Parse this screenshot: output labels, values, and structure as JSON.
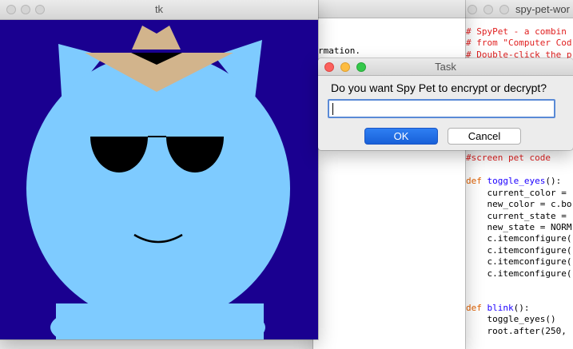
{
  "tk_window": {
    "title": "tk"
  },
  "shell_window": {
    "text": "rmation."
  },
  "code_window": {
    "title": "spy-pet-wor",
    "lines": [
      {
        "t": "# SpyPet - a combin",
        "c": "c-red"
      },
      {
        "t": "# from \"Computer Cod",
        "c": "c-red"
      },
      {
        "t": "# Double-click the p",
        "c": "c-red"
      },
      {
        "t": "",
        "c": ""
      },
      {
        "t": "",
        "c": ""
      },
      {
        "t": "",
        "c": ""
      },
      {
        "t": "",
        "c": ""
      },
      {
        "t": "",
        "c": ""
      },
      {
        "t": "",
        "c": ""
      },
      {
        "t": "",
        "c": ""
      },
      {
        "t": "",
        "c": ""
      },
      {
        "t": "#screen pet code",
        "c": "c-red"
      },
      {
        "t": "",
        "c": ""
      },
      {
        "t": "def toggle_eyes():",
        "c": "def"
      },
      {
        "t": "    current_color =",
        "c": ""
      },
      {
        "t": "    new_color = c.bo",
        "c": ""
      },
      {
        "t": "    current_state =",
        "c": ""
      },
      {
        "t": "    new_state = NORM",
        "c": ""
      },
      {
        "t": "    c.itemconfigure(",
        "c": ""
      },
      {
        "t": "    c.itemconfigure(",
        "c": ""
      },
      {
        "t": "    c.itemconfigure(",
        "c": ""
      },
      {
        "t": "    c.itemconfigure(",
        "c": ""
      },
      {
        "t": "",
        "c": ""
      },
      {
        "t": "",
        "c": ""
      },
      {
        "t": "def blink():",
        "c": "def"
      },
      {
        "t": "    toggle_eyes()",
        "c": ""
      },
      {
        "t": "    root.after(250,",
        "c": ""
      }
    ]
  },
  "dialog": {
    "title": "Task",
    "prompt": "Do you want Spy Pet to encrypt or decrypt?",
    "input_value": "",
    "ok_label": "OK",
    "cancel_label": "Cancel"
  },
  "colors": {
    "canvas_bg": "#1a0090",
    "pet_body": "#7ecbff",
    "hat": "#d2b48c",
    "glasses": "#000000"
  }
}
